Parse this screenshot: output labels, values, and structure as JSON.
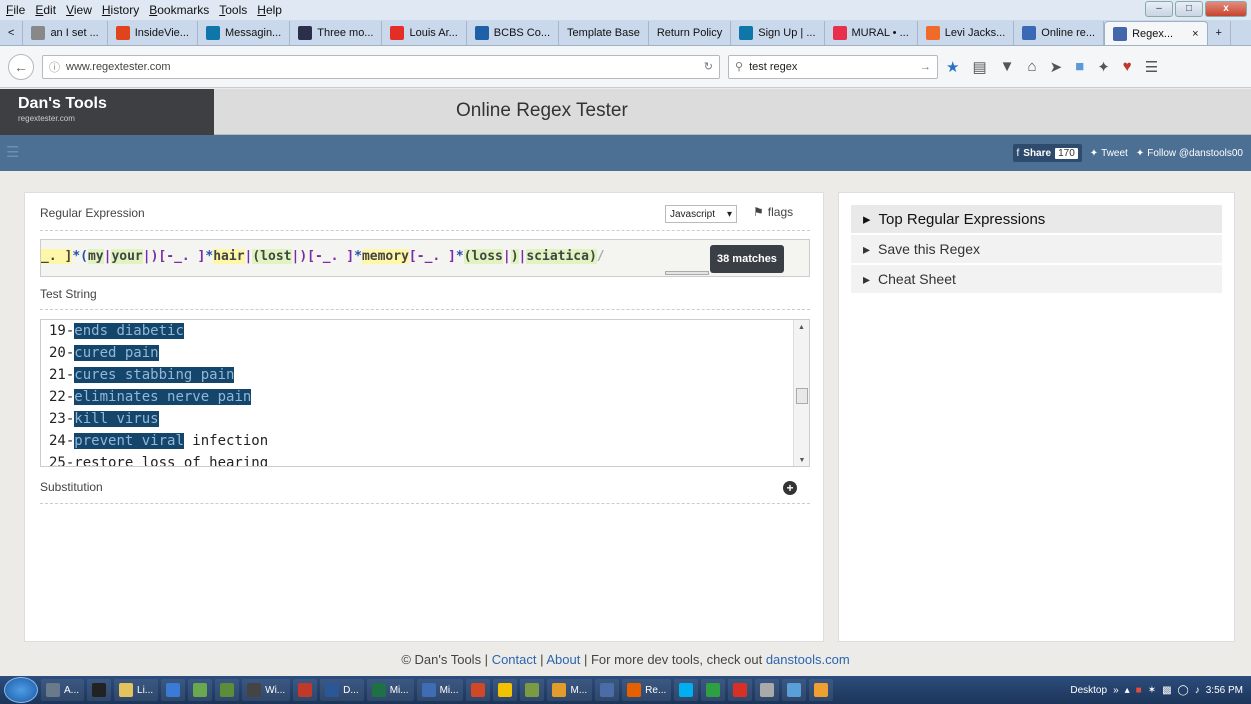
{
  "menu": [
    "File",
    "Edit",
    "View",
    "History",
    "Bookmarks",
    "Tools",
    "Help"
  ],
  "window_controls": {
    "min": "–",
    "max": "□",
    "close": "x"
  },
  "tabs": [
    {
      "label": "an I set ...",
      "color": "#888"
    },
    {
      "label": "InsideVie...",
      "color": "#e0441d"
    },
    {
      "label": "Messagin...",
      "color": "#0e76a8"
    },
    {
      "label": "Three mo...",
      "color": "#2b2f4a"
    },
    {
      "label": "Louis Ar...",
      "color": "#e52d27"
    },
    {
      "label": "BCBS Co...",
      "color": "#1f5fa8"
    },
    {
      "label": "Template Base",
      "color": ""
    },
    {
      "label": "Return Policy",
      "color": ""
    },
    {
      "label": "Sign Up | ...",
      "color": "#0e76a8"
    },
    {
      "label": "MURAL • ...",
      "color": "#e8304e"
    },
    {
      "label": "Levi Jacks...",
      "color": "#f06a2a"
    },
    {
      "label": "Online re...",
      "color": "#3b69b5"
    },
    {
      "label": "Regex...",
      "color": "#4466aa"
    }
  ],
  "active_tab_close": "×",
  "tab_new": "+",
  "url": "www.regextester.com",
  "search_query": "test regex",
  "site": {
    "logo_name": "Dan's Tools",
    "logo_sub": "regextester.com",
    "title": "Online Regex Tester"
  },
  "social": {
    "share_label": "Share",
    "share_count": "170",
    "tweet": "Tweet",
    "follow": "Follow @danstools00"
  },
  "regex_panel": {
    "label": "Regular Expression",
    "engine": "Javascript",
    "flags": "flags"
  },
  "regex_parts": {
    "p1": "_. ]",
    "p2": "*(",
    "p3": "my",
    "p4": "|",
    "p5": "your",
    "p6": "|",
    "p7": ")[-_. ]",
    "p8": "*",
    "p9": "hair",
    "p10": "|",
    "p11": "(lost",
    "p12": "|",
    "p13": ")[-_. ]",
    "p14": "*",
    "p15": "memory",
    "p16": "[-_. ]",
    "p17": "*",
    "p18": "(loss",
    "p19": "|",
    "p20": ")",
    "p21": "|",
    "p22": "sciatica)",
    "p23": "/"
  },
  "matches_badge": "38 matches",
  "test_label": "Test String",
  "test_lines": [
    {
      "pre": "19-",
      "match": "ends diabetic",
      "post": ""
    },
    {
      "pre": "20-",
      "match": "cured pain",
      "post": ""
    },
    {
      "pre": "21-",
      "match": "cures stabbing pain",
      "post": ""
    },
    {
      "pre": "22-",
      "match": "eliminates nerve pain",
      "post": ""
    },
    {
      "pre": "23-",
      "match": "kill virus",
      "post": ""
    },
    {
      "pre": "24-",
      "match": "prevent viral",
      "post": " infection"
    },
    {
      "pre": "25-restore loss of hearing",
      "match": "",
      "post": ""
    }
  ],
  "substitution_label": "Substitution",
  "right_items": [
    "Top Regular Expressions",
    "Save this Regex",
    "Cheat Sheet"
  ],
  "footer": {
    "copyright": "© Dan's Tools | ",
    "contact": "Contact",
    "sep1": " | ",
    "about": "About",
    "rest": " | For more dev tools, check out ",
    "link": "danstools.com"
  },
  "taskbar": [
    {
      "label": "A...",
      "color": "#6a7a8a"
    },
    {
      "label": "",
      "color": "#222"
    },
    {
      "label": "Li...",
      "color": "#e3c35d"
    },
    {
      "label": "",
      "color": "#3a7bd5"
    },
    {
      "label": "",
      "color": "#6aa84f"
    },
    {
      "label": "",
      "color": "#5b8d3a"
    },
    {
      "label": "Wi...",
      "color": "#444"
    },
    {
      "label": "",
      "color": "#c0392b"
    },
    {
      "label": "D...",
      "color": "#2b5797"
    },
    {
      "label": "Mi...",
      "color": "#1e7145"
    },
    {
      "label": "Mi...",
      "color": "#3e6db5"
    },
    {
      "label": "",
      "color": "#d24726"
    },
    {
      "label": "",
      "color": "#f2c200"
    },
    {
      "label": "",
      "color": "#7a9b43"
    },
    {
      "label": "M...",
      "color": "#e39b2a"
    },
    {
      "label": "",
      "color": "#4a6da7"
    },
    {
      "label": "Re...",
      "color": "#e66000"
    },
    {
      "label": "",
      "color": "#00aff0"
    },
    {
      "label": "",
      "color": "#2ea043"
    },
    {
      "label": "",
      "color": "#d93025"
    },
    {
      "label": "",
      "color": "#aaa"
    },
    {
      "label": "",
      "color": "#5aa0d8"
    },
    {
      "label": "",
      "color": "#f0a030"
    }
  ],
  "tray": {
    "desktop": "Desktop",
    "chev": "»",
    "time": "3:56 PM"
  }
}
